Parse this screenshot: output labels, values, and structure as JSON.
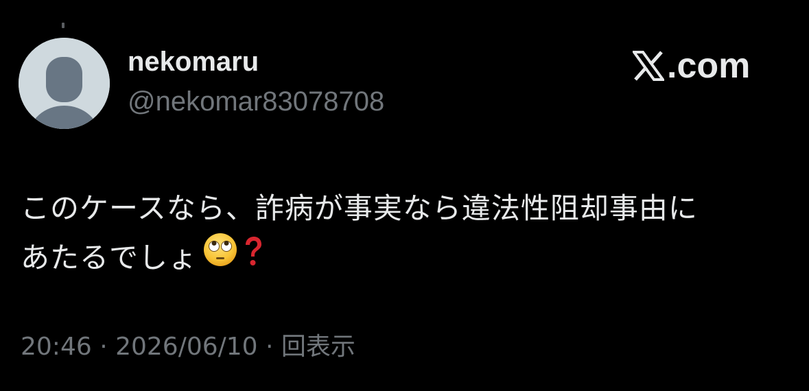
{
  "author": {
    "display_name": "nekomaru",
    "handle": "@nekomar83078708",
    "avatar_icon": "default-avatar-icon"
  },
  "brand": {
    "label": ".com",
    "logo_icon": "x-logo-icon"
  },
  "tweet": {
    "line1": "このケースなら、詐病が事実なら違法性阻却事由に",
    "line2": "あたるでしょ",
    "emojis": [
      "face-with-rolling-eyes-icon",
      "red-question-mark-icon"
    ]
  },
  "meta": {
    "text": "20:46 · 2026/06/10 · 回表示"
  },
  "colors": {
    "background": "#000000",
    "primary_text": "#e7e9ea",
    "secondary_text": "#71767b",
    "avatar_bg": "#cfd9de",
    "avatar_fg": "#687684",
    "question_mark": "#d8262f",
    "emoji_face": "#f7c437"
  }
}
